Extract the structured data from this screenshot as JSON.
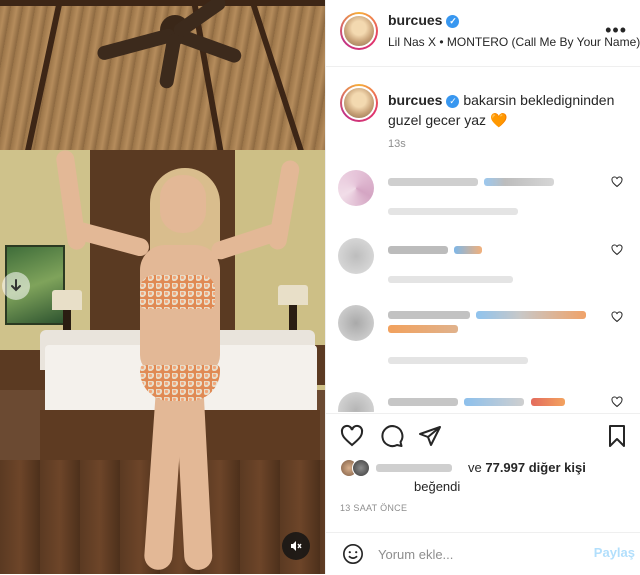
{
  "post": {
    "username": "burcues",
    "audio": "Lil Nas X • MONTERO (Call Me By Your Name)",
    "more_icon": "more-horizontal-icon"
  },
  "caption": {
    "username": "burcues",
    "text": "bakarsin bekledigninden guzel gecer yaz",
    "emoji": "🧡",
    "time": "13s"
  },
  "comments": [
    {
      "like_icon": "heart-outline-icon"
    },
    {
      "like_icon": "heart-outline-icon"
    },
    {
      "like_icon": "heart-outline-icon"
    },
    {
      "like_icon": "heart-outline-icon"
    }
  ],
  "actions": {
    "like_icon": "heart-outline-icon",
    "comment_icon": "comment-bubble-icon",
    "share_icon": "paper-plane-icon",
    "save_icon": "bookmark-icon"
  },
  "likes": {
    "prefix": "ve",
    "count_text": "77.997 diğer kişi",
    "suffix": "beğendi"
  },
  "timestamp": "13 SAAT ÖNCE",
  "comment_input": {
    "placeholder": "Yorum ekle...",
    "submit_label": "Paylaş"
  },
  "colors": {
    "verified": "#3897f0",
    "share_disabled": "#b2dffc",
    "muted_text": "#8e8e8e",
    "border": "#efefef"
  }
}
